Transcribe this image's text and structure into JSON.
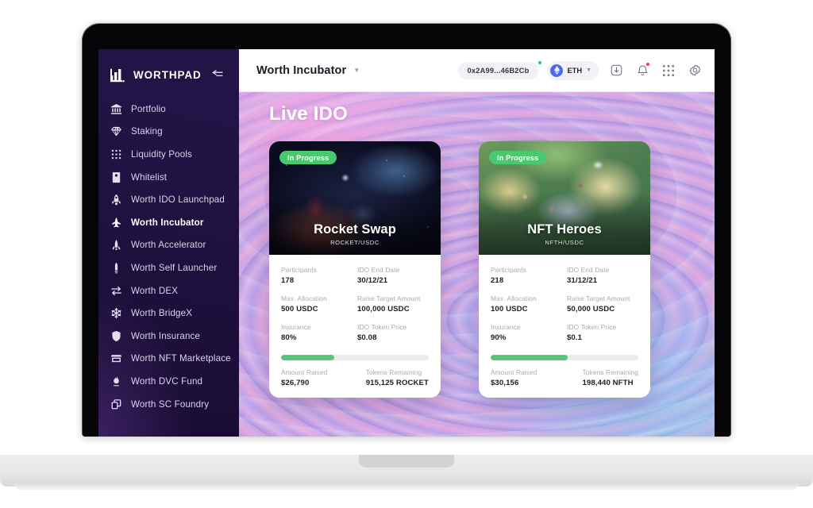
{
  "brand": {
    "name": "WORTHPAD",
    "logo_icon": "worthpad-bars-logo",
    "collapse_icon": "collapse-sidebar-icon"
  },
  "sidebar": {
    "items": [
      {
        "label": "Portfolio",
        "icon": "bank-icon",
        "active": false
      },
      {
        "label": "Staking",
        "icon": "gem-icon",
        "active": false
      },
      {
        "label": "Liquidity Pools",
        "icon": "grid-dots-icon",
        "active": false
      },
      {
        "label": "Whitelist",
        "icon": "id-card-icon",
        "active": false
      },
      {
        "label": "Worth IDO Launchpad",
        "icon": "rocket-icon",
        "active": false
      },
      {
        "label": "Worth Incubator",
        "icon": "jet-icon",
        "active": true
      },
      {
        "label": "Worth Accelerator",
        "icon": "shuttle-icon",
        "active": false
      },
      {
        "label": "Worth Self Launcher",
        "icon": "missile-icon",
        "active": false
      },
      {
        "label": "Worth DEX",
        "icon": "swap-arrows-icon",
        "active": false
      },
      {
        "label": "Worth BridgeX",
        "icon": "snowflake-icon",
        "active": false
      },
      {
        "label": "Worth Insurance",
        "icon": "shield-icon",
        "active": false
      },
      {
        "label": "Worth NFT Marketplace",
        "icon": "storefront-icon",
        "active": false
      },
      {
        "label": "Worth DVC Fund",
        "icon": "flame-icon",
        "active": false
      },
      {
        "label": "Worth SC Foundry",
        "icon": "copy-layers-icon",
        "active": false
      }
    ]
  },
  "topbar": {
    "title": "Worth Incubator",
    "title_caret_icon": "chevron-down-icon",
    "wallet": {
      "address": "0x2A99...46B2Cb",
      "status_dot_color": "#2bc46a"
    },
    "chain": {
      "name": "ETH",
      "icon": "ethereum-icon",
      "caret_icon": "chevron-down-icon",
      "color": "#4a6cf0"
    },
    "actions": [
      {
        "icon": "download-icon",
        "badge": false
      },
      {
        "icon": "bell-icon",
        "badge": true,
        "badge_color": "#ff3b4e"
      },
      {
        "icon": "apps-grid-icon",
        "badge": false
      },
      {
        "icon": "gear-icon",
        "badge": false
      }
    ]
  },
  "main": {
    "heading": "Live IDO",
    "field_labels": {
      "participants": "Participants",
      "end_date": "IDO End Date",
      "max_allocation": "Max. Allocation",
      "raise_target": "Raise Target Amount",
      "insurance": "Insurance",
      "token_price": "IDO Token Price",
      "amount_raised": "Amount Raised",
      "tokens_remaining": "Tokens Remaining"
    },
    "cards": [
      {
        "badge": "In Progress",
        "name": "Rocket Swap",
        "pair": "ROCKET/USDC",
        "participants": "178",
        "end_date": "30/12/21",
        "max_allocation": "500 USDC",
        "raise_target": "100,000 USDC",
        "insurance": "80%",
        "token_price": "$0.08",
        "progress_percent": 36,
        "amount_raised": "$26,790",
        "tokens_remaining": "915,125 ROCKET"
      },
      {
        "badge": "In Progress",
        "name": "NFT Heroes",
        "pair": "NFTH/USDC",
        "participants": "218",
        "end_date": "31/12/21",
        "max_allocation": "100 USDC",
        "raise_target": "50,000 USDC",
        "insurance": "90%",
        "token_price": "$0.1",
        "progress_percent": 52,
        "amount_raised": "$30,156",
        "tokens_remaining": "198,440 NFTH"
      }
    ]
  },
  "colors": {
    "accent_green": "#4ac86f",
    "sidebar_dark": "#1f1140",
    "brand_blue": "#4a6cf0"
  }
}
